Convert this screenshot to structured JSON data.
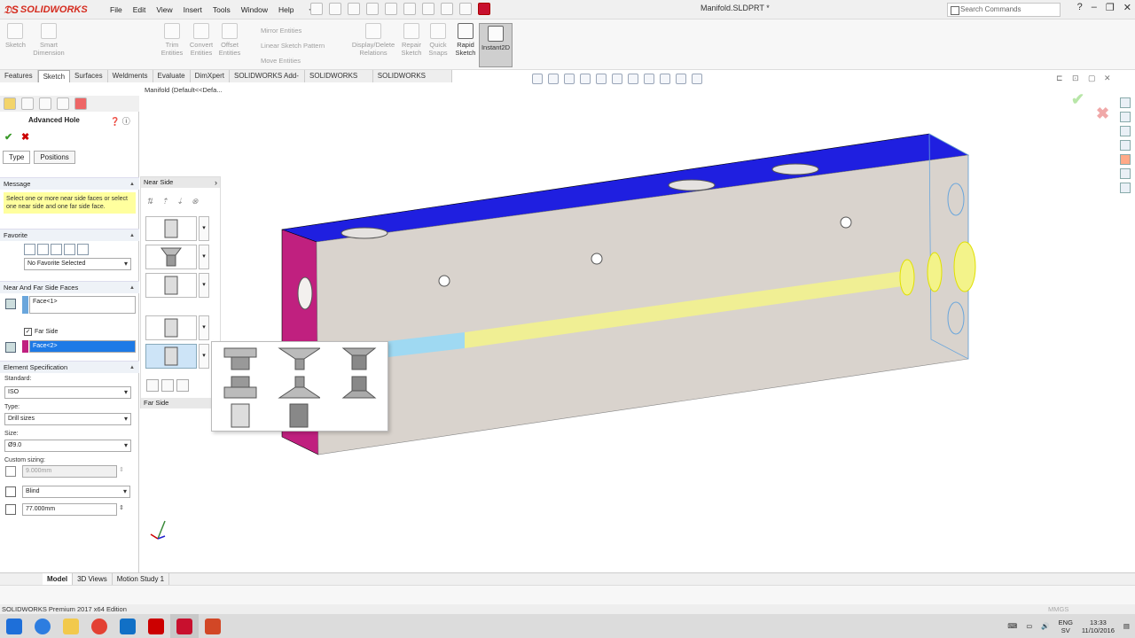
{
  "app": {
    "brand": "SOLIDWORKS",
    "document_title": "Manifold.SLDPRT *",
    "menus": [
      "File",
      "Edit",
      "View",
      "Insert",
      "Tools",
      "Window",
      "Help"
    ],
    "search_placeholder": "Search Commands"
  },
  "ribbon": {
    "sketch": "Sketch",
    "smart_dimension": "Smart Dimension",
    "trim_entities": "Trim Entities",
    "convert_entities": "Convert Entities",
    "offset_entities": "Offset Entities",
    "mirror_entities": "Mirror Entities",
    "linear_sketch_pattern": "Linear Sketch Pattern",
    "move_entities": "Move Entities",
    "display_delete_relations": "Display/Delete Relations",
    "repair_sketch": "Repair Sketch",
    "quick_snaps": "Quick Snaps",
    "rapid_sketch": "Rapid Sketch",
    "instant2d": "Instant2D"
  },
  "tabs": [
    "Features",
    "Sketch",
    "Surfaces",
    "Weldments",
    "Evaluate",
    "DimXpert",
    "SOLIDWORKS Add-Ins",
    "SOLIDWORKS MBD",
    "SOLIDWORKS Visualize"
  ],
  "active_tab": "Sketch",
  "property_manager": {
    "title": "Advanced Hole",
    "tabs": [
      "Type",
      "Positions"
    ],
    "message_header": "Message",
    "message": "Select one or more near side faces or select one near side and one far side face.",
    "favorite_header": "Favorite",
    "favorite_value": "No Favorite Selected",
    "faces_header": "Near And Far Side Faces",
    "near_face": "Face<1>",
    "far_side_label": "Far Side",
    "far_face": "Face<2>",
    "element_header": "Element Specification",
    "standard_label": "Standard:",
    "standard_value": "ISO",
    "type_label": "Type:",
    "type_value": "Drill sizes",
    "size_label": "Size:",
    "size_value": "Ø9.0",
    "custom_label": "Custom sizing:",
    "custom_value": "9.000mm",
    "end_condition": "Blind",
    "depth_value": "77.000mm"
  },
  "fly_panel": {
    "near_side": "Near Side",
    "far_side": "Far Side"
  },
  "tree": {
    "root": "Manifold  (Default<<Defa..."
  },
  "bottom_tabs": [
    "Model",
    "3D Views",
    "Motion Study 1"
  ],
  "status": {
    "edition": "SOLIDWORKS Premium 2017 x64 Edition",
    "units": "MMGS"
  },
  "tray": {
    "lang": "ENG",
    "region": "SV",
    "time": "13:33",
    "date": "11/10/2016"
  },
  "colors": {
    "model_face": "#d9d3cd",
    "top_face": "#1f1fe0",
    "end_face": "#c0207f",
    "hole_preview": "#f3f38a",
    "hole_start": "#9fd9f2",
    "message_bg": "#ffff9e",
    "accent": "#3a79c8"
  }
}
